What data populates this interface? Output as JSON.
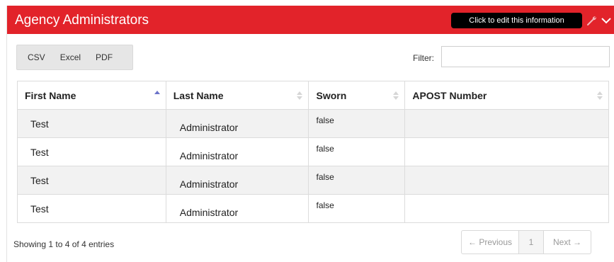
{
  "panel": {
    "title": "Agency Administrators",
    "tooltip": "Click to edit this information",
    "icons": [
      "wrench-icon",
      "chevron-down-icon"
    ],
    "header_color": "#e2232a"
  },
  "toolbar": {
    "csv_label": "CSV",
    "excel_label": "Excel",
    "pdf_label": "PDF",
    "filter_label": "Filter:",
    "filter_value": ""
  },
  "table": {
    "headers": [
      "First Name",
      "Last Name",
      "Sworn",
      "APOST Number"
    ],
    "sorted_column": "First Name",
    "sort_direction": "ascending",
    "rows": [
      {
        "first": "Test",
        "last": "Administrator",
        "sworn": "false",
        "apost": ""
      },
      {
        "first": "Test",
        "last": "Administrator",
        "sworn": "false",
        "apost": ""
      },
      {
        "first": "Test",
        "last": "Administrator",
        "sworn": "false",
        "apost": ""
      },
      {
        "first": "Test",
        "last": "Administrator",
        "sworn": "false",
        "apost": ""
      }
    ]
  },
  "footer": {
    "info": "Showing 1 to 4 of 4 entries",
    "prev_label": "← Previous",
    "page_label": "1",
    "next_label": "Next →"
  }
}
